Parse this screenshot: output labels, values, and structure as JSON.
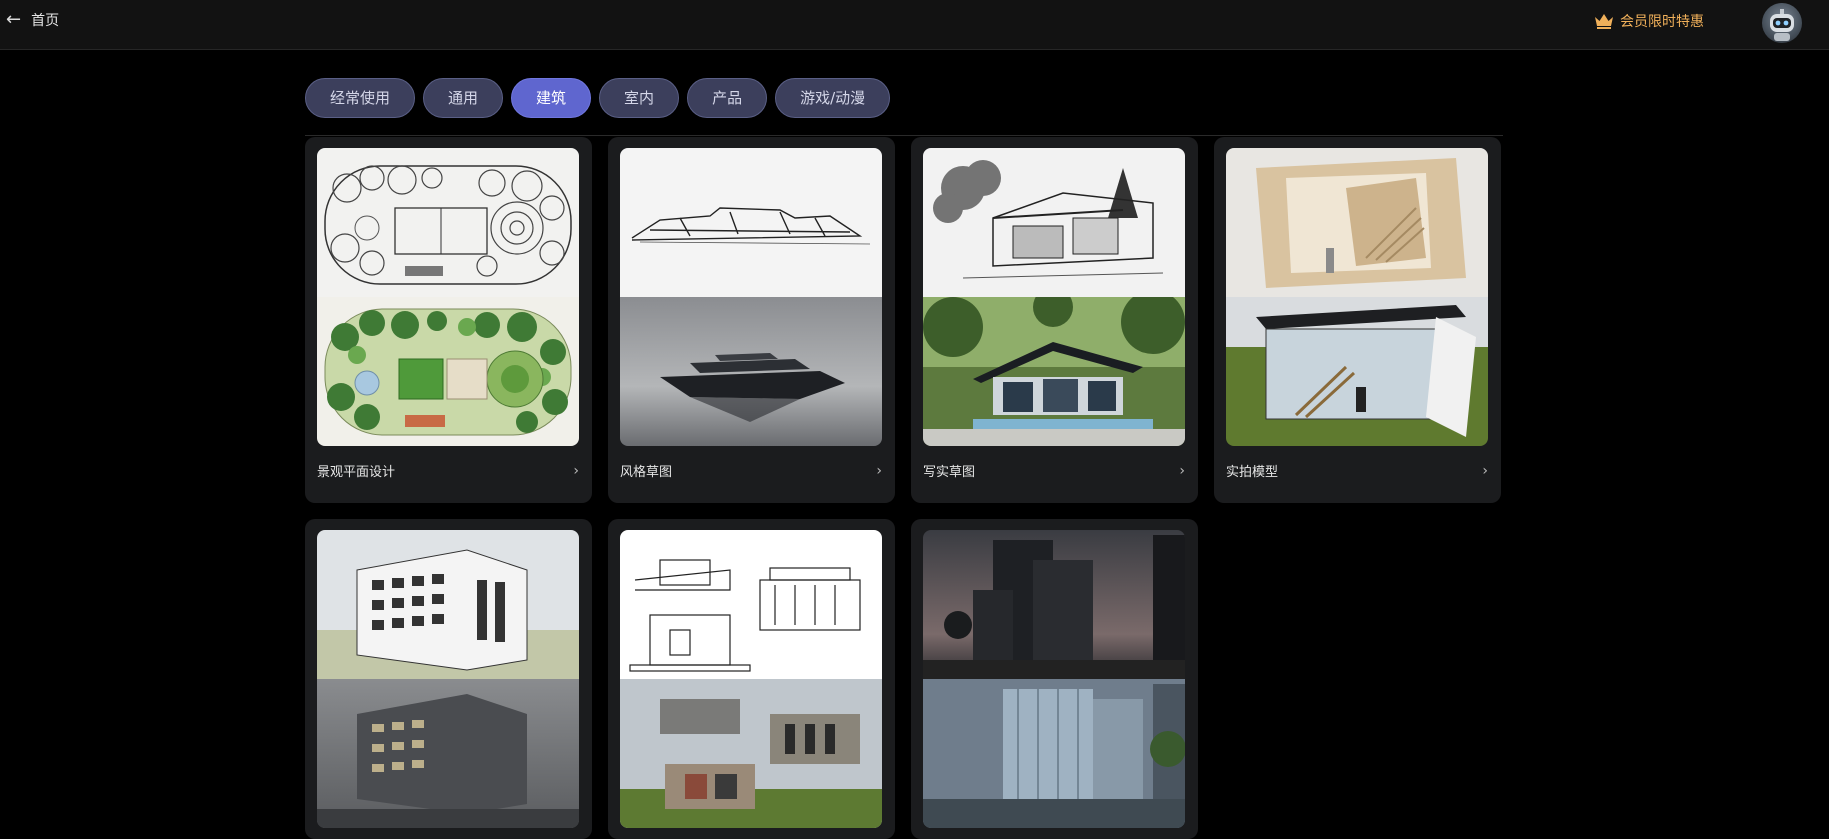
{
  "header": {
    "back_label": "首页",
    "promo_label": "会员限时特惠",
    "promo_color": "#f0b05a"
  },
  "tabs": [
    {
      "label": "经常使用",
      "active": false
    },
    {
      "label": "通用",
      "active": false
    },
    {
      "label": "建筑",
      "active": true
    },
    {
      "label": "室内",
      "active": false
    },
    {
      "label": "产品",
      "active": false
    },
    {
      "label": "游戏/动漫",
      "active": false
    }
  ],
  "cards": [
    {
      "title": "景观平面设计"
    },
    {
      "title": "风格草图"
    },
    {
      "title": "写实草图"
    },
    {
      "title": "实拍模型"
    },
    {
      "title": ""
    },
    {
      "title": ""
    },
    {
      "title": ""
    }
  ],
  "icons": {
    "back": "arrow-left-icon",
    "promo": "crown-icon",
    "chevron": "chevron-right-icon"
  },
  "colors": {
    "active_tab": "#5f66cf",
    "tab": "#3c3f5c",
    "card": "#1b1c1e"
  }
}
